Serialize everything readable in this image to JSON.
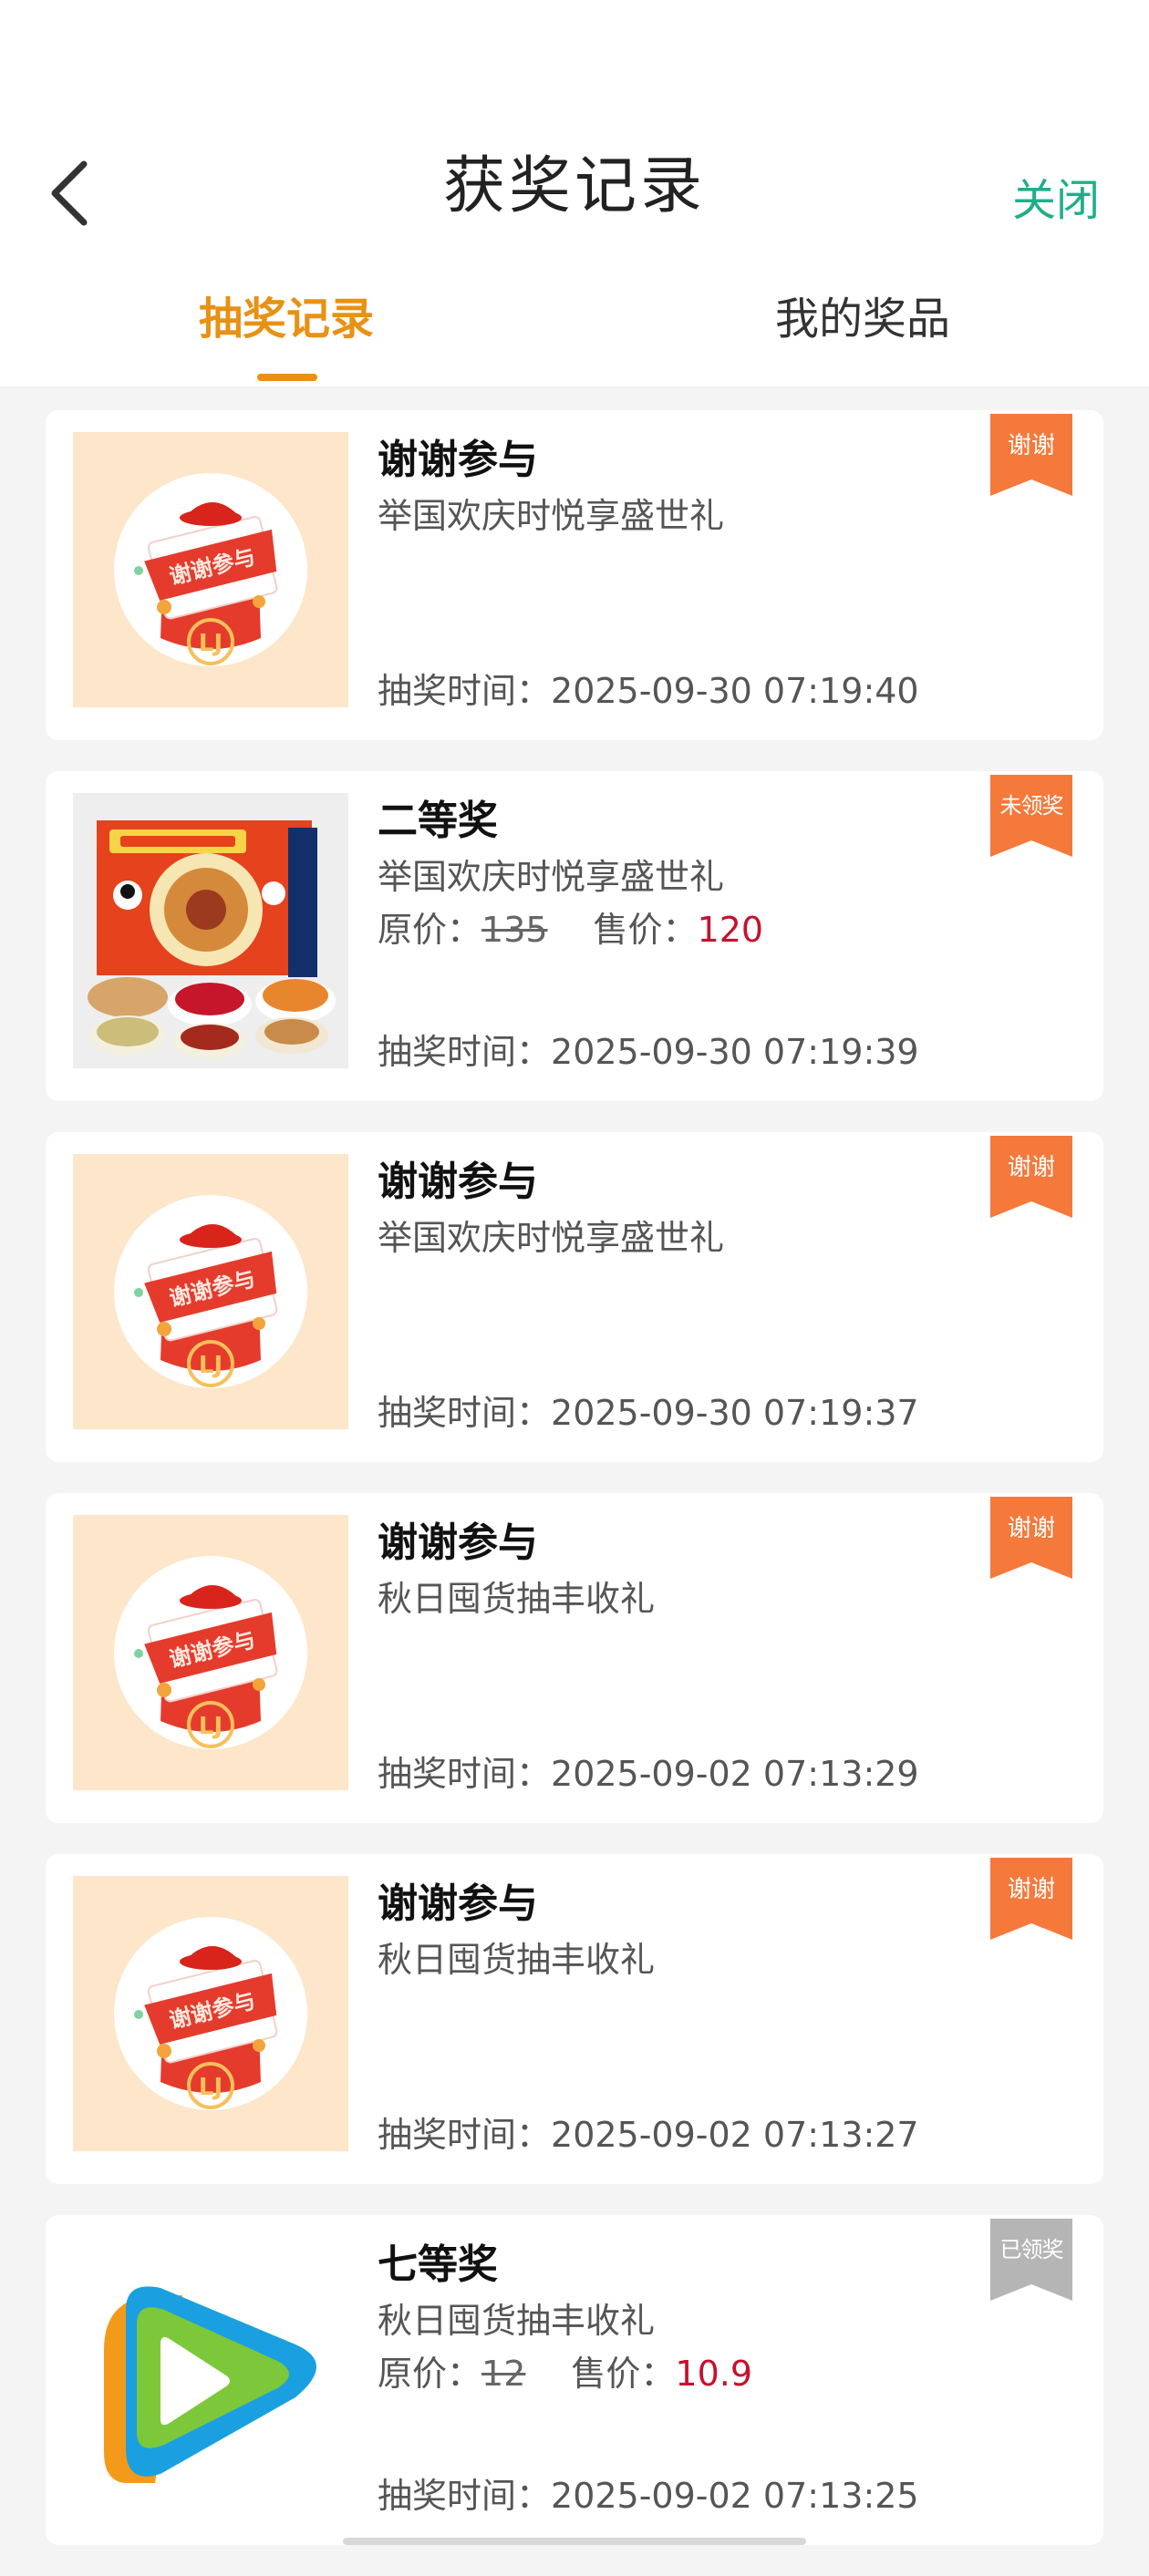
{
  "header": {
    "title": "获奖记录",
    "close_label": "关闭"
  },
  "tabs": [
    {
      "label": "抽奖记录",
      "active": true
    },
    {
      "label": "我的奖品",
      "active": false
    }
  ],
  "colors": {
    "accent": "#e89113",
    "close": "#1fae8a",
    "ribbon_pending": "#f5793b",
    "ribbon_claimed": "#b5b5b5",
    "sale_price": "#c8102e"
  },
  "records": [
    {
      "prize": "谢谢参与",
      "activity": "举国欢庆时悦享盛世礼",
      "time_label": "抽奖时间：",
      "time": "2025-09-30 07:19:40",
      "status": "谢谢",
      "image": "thanks-participation-image"
    },
    {
      "prize": "二等奖",
      "activity": "举国欢庆时悦享盛世礼",
      "original_label": "原价：",
      "original_price": "135",
      "sale_label": "售价：",
      "sale_price": "120",
      "time_label": "抽奖时间：",
      "time": "2025-09-30 07:19:39",
      "status": "未领奖",
      "image": "snack-gift-box-image"
    },
    {
      "prize": "谢谢参与",
      "activity": "举国欢庆时悦享盛世礼",
      "time_label": "抽奖时间：",
      "time": "2025-09-30 07:19:37",
      "status": "谢谢",
      "image": "thanks-participation-image"
    },
    {
      "prize": "谢谢参与",
      "activity": "秋日囤货抽丰收礼",
      "time_label": "抽奖时间：",
      "time": "2025-09-02 07:13:29",
      "status": "谢谢",
      "image": "thanks-participation-image"
    },
    {
      "prize": "谢谢参与",
      "activity": "秋日囤货抽丰收礼",
      "time_label": "抽奖时间：",
      "time": "2025-09-02 07:13:27",
      "status": "谢谢",
      "image": "thanks-participation-image"
    },
    {
      "prize": "七等奖",
      "activity": "秋日囤货抽丰收礼",
      "original_label": "原价：",
      "original_price": "12",
      "sale_label": "售价：",
      "sale_price": "10.9",
      "time_label": "抽奖时间：",
      "time": "2025-09-02 07:13:25",
      "status": "已领奖",
      "image": "video-app-logo-image"
    }
  ],
  "thanks_image_text": "谢谢参与",
  "thanks_image_logo": "LJ"
}
